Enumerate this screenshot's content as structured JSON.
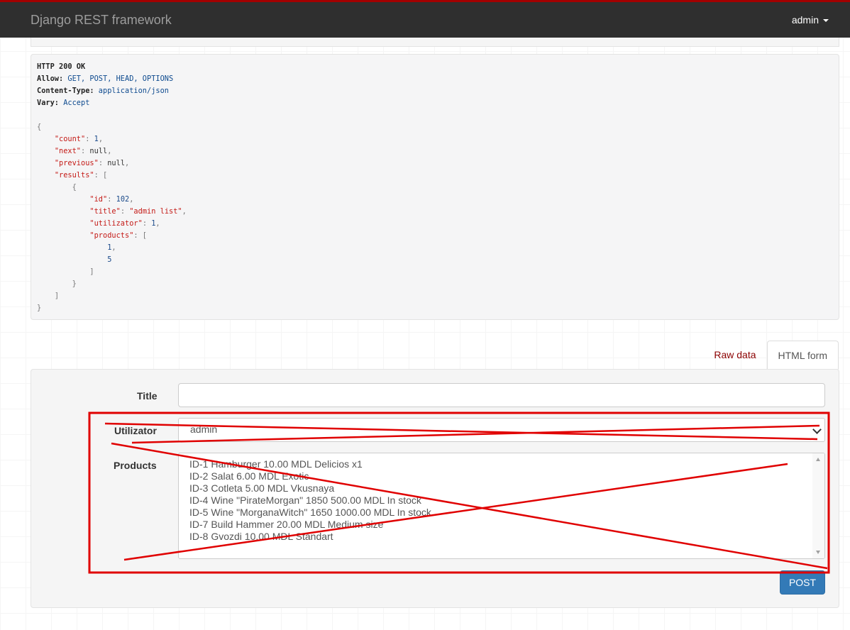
{
  "navbar": {
    "brand": "Django REST framework",
    "user": "admin",
    "accent_color": "#a30000",
    "background_color": "#2f2f2f"
  },
  "response": {
    "status": "HTTP 200 OK",
    "headers": [
      {
        "name": "Allow:",
        "value": "GET, POST, HEAD, OPTIONS"
      },
      {
        "name": "Content-Type:",
        "value": "application/json"
      },
      {
        "name": "Vary:",
        "value": "Accept"
      }
    ],
    "body": {
      "count_key": "\"count\"",
      "count_value": "1",
      "next_key": "\"next\"",
      "next_value": "null",
      "previous_key": "\"previous\"",
      "previous_value": "null",
      "results_key": "\"results\"",
      "item": {
        "id_key": "\"id\"",
        "id_value": "102",
        "title_key": "\"title\"",
        "title_value": "\"admin list\"",
        "utilizator_key": "\"utilizator\"",
        "utilizator_value": "1",
        "products_key": "\"products\"",
        "products_values": [
          "1",
          "5"
        ]
      }
    }
  },
  "tabs": {
    "raw": "Raw data",
    "html": "HTML form",
    "active": "HTML form"
  },
  "form": {
    "title_label": "Title",
    "title_value": "",
    "utilizator_label": "Utilizator",
    "utilizator_selected": "admin",
    "products_label": "Products",
    "products_options": [
      "ID-1 Hamburger 10.00 MDL Delicios x1",
      "ID-2 Salat 6.00 MDL Exotic",
      "ID-3 Cotleta 5.00 MDL Vkusnaya",
      "ID-4 Wine \"PirateMorgan\" 1850 500.00 MDL In stock",
      "ID-5 Wine \"MorganaWitch\" 1650 1000.00 MDL In stock",
      "ID-7 Build Hammer 20.00 MDL Medium size",
      "ID-8 Gvozdi 10.00 MDL Standart"
    ],
    "submit_label": "POST",
    "button_color": "#337ab7"
  },
  "annotation": {
    "color": "#e00000"
  }
}
